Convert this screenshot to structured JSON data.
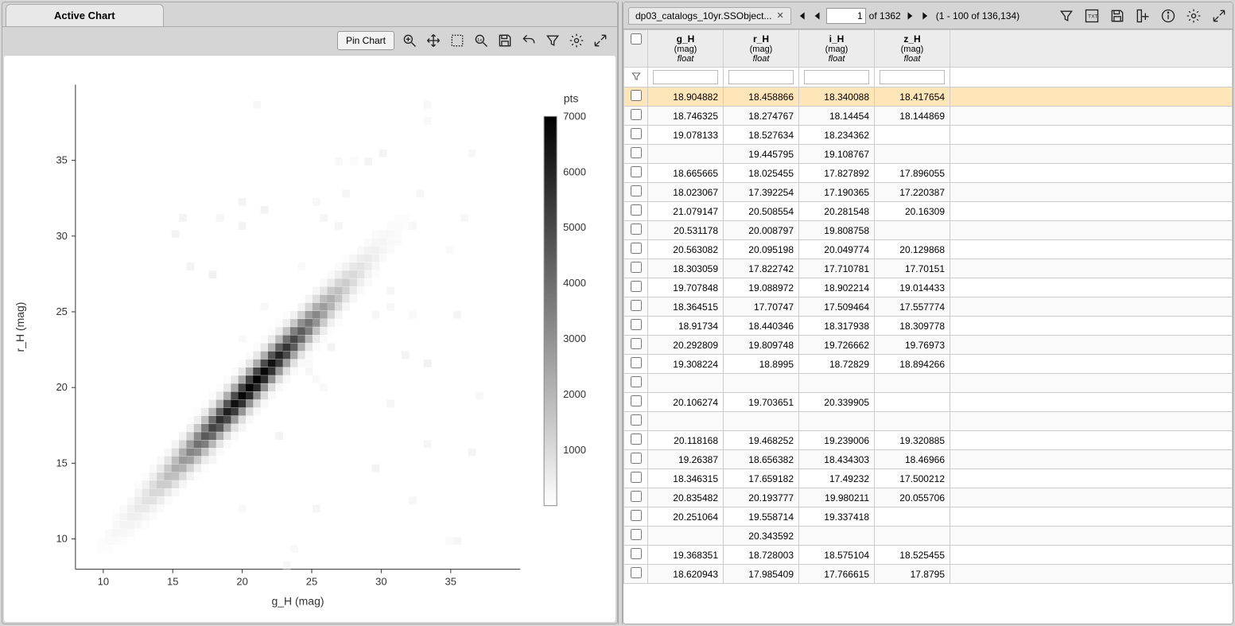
{
  "left": {
    "tab_label": "Active Chart",
    "pin_label": "Pin Chart"
  },
  "chart_data": {
    "type": "heatmap",
    "xlabel": "g_H (mag)",
    "ylabel": "r_H (mag)",
    "cbar_label": "pts",
    "xticks": [
      10,
      15,
      20,
      25,
      30,
      35
    ],
    "yticks": [
      10,
      15,
      20,
      25,
      30,
      35
    ],
    "cbar_ticks": [
      1000,
      2000,
      3000,
      4000,
      5000,
      6000,
      7000
    ],
    "xlim": [
      8,
      40
    ],
    "ylim": [
      8,
      40
    ],
    "cbar_range": [
      0,
      7000
    ],
    "note": "2D density of r_H vs g_H; values concentrated along diagonal r_H≈g_H with peak density near (21,20)."
  },
  "table": {
    "tab_label": "dp03_catalogs_10yr.SSObject...",
    "page_value": "1",
    "page_total_label": "of 1362",
    "range_label": "(1 - 100 of 136,134)",
    "columns": [
      {
        "name": "g_H",
        "unit": "(mag)",
        "type": "float"
      },
      {
        "name": "r_H",
        "unit": "(mag)",
        "type": "float"
      },
      {
        "name": "i_H",
        "unit": "(mag)",
        "type": "float"
      },
      {
        "name": "z_H",
        "unit": "(mag)",
        "type": "float"
      }
    ],
    "rows": [
      [
        "18.904882",
        "18.458866",
        "18.340088",
        "18.417654"
      ],
      [
        "18.746325",
        "18.274767",
        "18.14454",
        "18.144869"
      ],
      [
        "19.078133",
        "18.527634",
        "18.234362",
        ""
      ],
      [
        "",
        "19.445795",
        "19.108767",
        ""
      ],
      [
        "18.665665",
        "18.025455",
        "17.827892",
        "17.896055"
      ],
      [
        "18.023067",
        "17.392254",
        "17.190365",
        "17.220387"
      ],
      [
        "21.079147",
        "20.508554",
        "20.281548",
        "20.16309"
      ],
      [
        "20.531178",
        "20.008797",
        "19.808758",
        ""
      ],
      [
        "20.563082",
        "20.095198",
        "20.049774",
        "20.129868"
      ],
      [
        "18.303059",
        "17.822742",
        "17.710781",
        "17.70151"
      ],
      [
        "19.707848",
        "19.088972",
        "18.902214",
        "19.014433"
      ],
      [
        "18.364515",
        "17.70747",
        "17.509464",
        "17.557774"
      ],
      [
        "18.91734",
        "18.440346",
        "18.317938",
        "18.309778"
      ],
      [
        "20.292809",
        "19.809748",
        "19.726662",
        "19.76973"
      ],
      [
        "19.308224",
        "18.8995",
        "18.72829",
        "18.894266"
      ],
      [
        "",
        "",
        "",
        ""
      ],
      [
        "20.106274",
        "19.703651",
        "20.339905",
        ""
      ],
      [
        "",
        "",
        "",
        ""
      ],
      [
        "20.118168",
        "19.468252",
        "19.239006",
        "19.320885"
      ],
      [
        "19.26387",
        "18.656382",
        "18.434303",
        "18.46966"
      ],
      [
        "18.346315",
        "17.659182",
        "17.49232",
        "17.500212"
      ],
      [
        "20.835482",
        "20.193777",
        "19.980211",
        "20.055706"
      ],
      [
        "20.251064",
        "19.558714",
        "19.337418",
        ""
      ],
      [
        "",
        "20.343592",
        "",
        ""
      ],
      [
        "19.368351",
        "18.728003",
        "18.575104",
        "18.525455"
      ],
      [
        "18.620943",
        "17.985409",
        "17.766615",
        "17.8795"
      ]
    ],
    "selected_row": 0
  }
}
